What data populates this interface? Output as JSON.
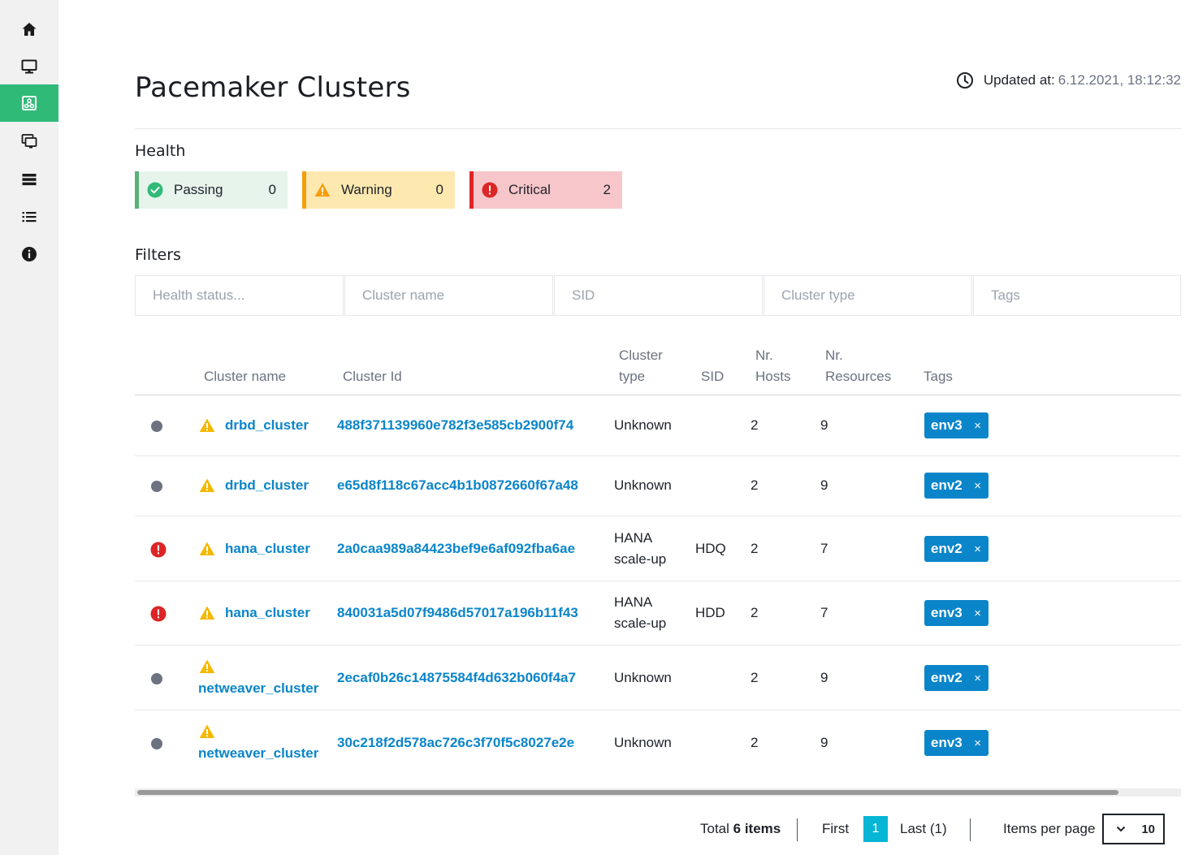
{
  "sidebar": {
    "items": [
      {
        "name": "home-icon"
      },
      {
        "name": "monitor-icon"
      },
      {
        "name": "clusters-icon"
      },
      {
        "name": "sap-systems-icon"
      },
      {
        "name": "databases-icon"
      },
      {
        "name": "checks-catalog-icon"
      },
      {
        "name": "about-icon"
      }
    ],
    "active_index": 2
  },
  "header": {
    "title": "Pacemaker Clusters",
    "updated_label": "Updated at:",
    "updated_value": "6.12.2021, 18:12:32"
  },
  "health": {
    "title": "Health",
    "passing": {
      "label": "Passing",
      "count": "0",
      "color": "#58b179"
    },
    "warning": {
      "label": "Warning",
      "count": "0",
      "color": "#f59e0b"
    },
    "critical": {
      "label": "Critical",
      "count": "2",
      "color": "#dc2626"
    }
  },
  "filters": {
    "title": "Filters",
    "health_status": "Health status...",
    "cluster_name": "Cluster name",
    "sid": "SID",
    "cluster_type": "Cluster type",
    "tags": "Tags"
  },
  "table": {
    "headers": {
      "cluster_name": "Cluster name",
      "cluster_id": "Cluster Id",
      "cluster_type_1": "Cluster",
      "cluster_type_2": "type",
      "sid": "SID",
      "hosts_1": "Nr.",
      "hosts_2": "Hosts",
      "resources_1": "Nr.",
      "resources_2": "Resources",
      "tags": "Tags"
    },
    "rows": [
      {
        "health": "unknown",
        "name": "drbd_cluster",
        "id": "488f371139960e782f3e585cb2900f74",
        "type1": "Unknown",
        "type2": "",
        "sid": "",
        "hosts": "2",
        "resources": "9",
        "tag": "env3",
        "tag_remove": "×"
      },
      {
        "health": "unknown",
        "name": "drbd_cluster",
        "id": "e65d8f118c67acc4b1b0872660f67a48",
        "type1": "Unknown",
        "type2": "",
        "sid": "",
        "hosts": "2",
        "resources": "9",
        "tag": "env2",
        "tag_remove": "×"
      },
      {
        "health": "critical",
        "name": "hana_cluster",
        "id": "2a0caa989a84423bef9e6af092fba6ae",
        "type1": "HANA",
        "type2": "scale-up",
        "sid": "HDQ",
        "hosts": "2",
        "resources": "7",
        "tag": "env2",
        "tag_remove": "×"
      },
      {
        "health": "critical",
        "name": "hana_cluster",
        "id": "840031a5d07f9486d57017a196b11f43",
        "type1": "HANA",
        "type2": "scale-up",
        "sid": "HDD",
        "hosts": "2",
        "resources": "7",
        "tag": "env3",
        "tag_remove": "×"
      },
      {
        "health": "unknown",
        "name": "netweaver_cluster",
        "id": "2ecaf0b26c14875584f4d632b060f4a7",
        "type1": "Unknown",
        "type2": "",
        "sid": "",
        "hosts": "2",
        "resources": "9",
        "tag": "env2",
        "tag_remove": "×"
      },
      {
        "health": "unknown",
        "name": "netweaver_cluster",
        "id": "30c218f2d578ac726c3f70f5c8027e2e",
        "type1": "Unknown",
        "type2": "",
        "sid": "",
        "hosts": "2",
        "resources": "9",
        "tag": "env3",
        "tag_remove": "×"
      }
    ]
  },
  "pagination": {
    "total_prefix": "Total",
    "total_count": "6 items",
    "first": "First",
    "current_page": "1",
    "last": "Last (1)",
    "items_per_page_label": "Items per page",
    "items_per_page_value": "10"
  }
}
